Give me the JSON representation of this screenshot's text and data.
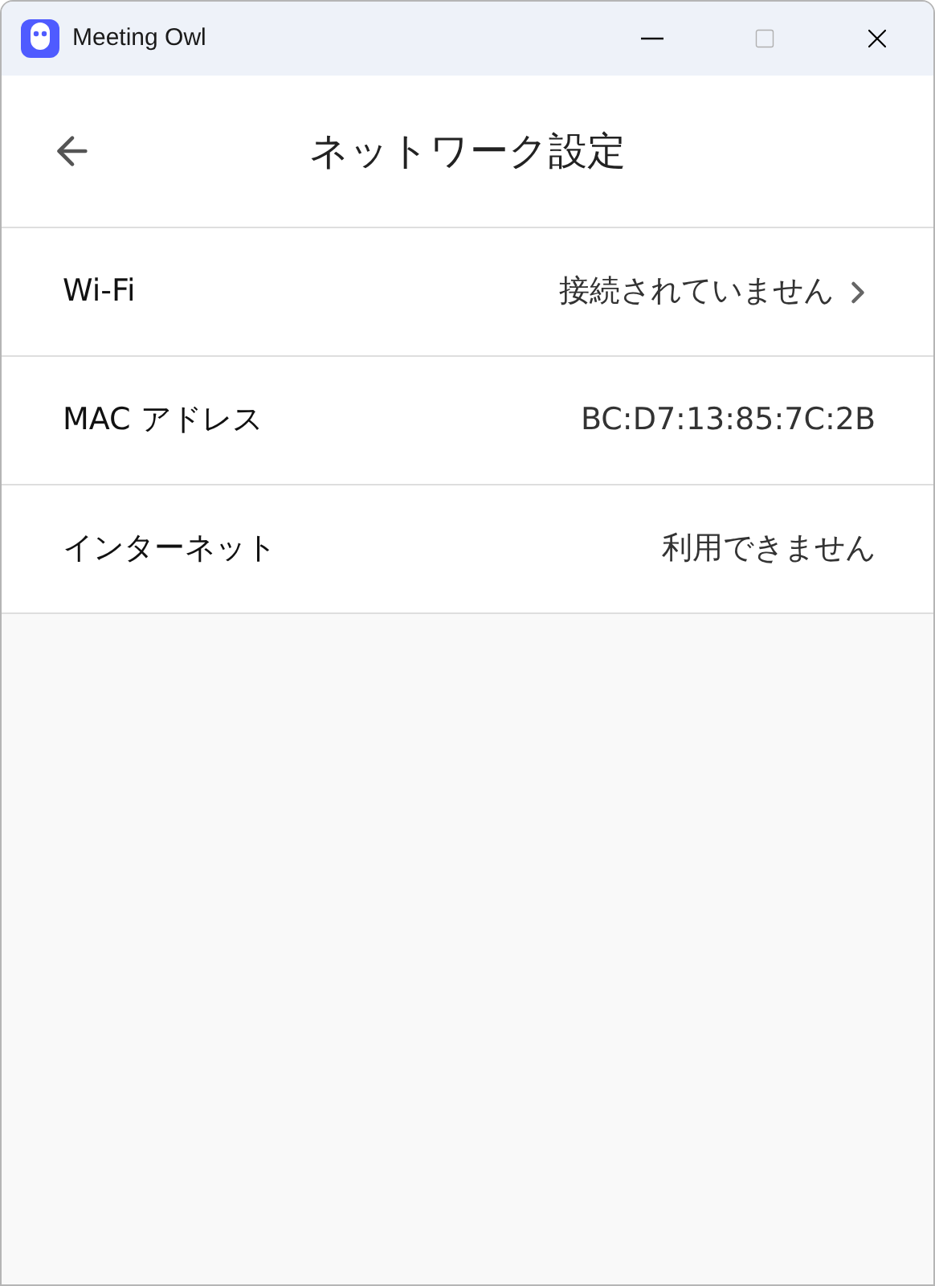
{
  "window": {
    "title": "Meeting Owl"
  },
  "header": {
    "title": "ネットワーク設定"
  },
  "rows": [
    {
      "kind": "link",
      "label": "Wi-Fi",
      "value": "接続されていません"
    },
    {
      "kind": "info",
      "label": "MAC アドレス",
      "value": "BC:D7:13:85:7C:2B"
    },
    {
      "kind": "info",
      "label": "インターネット",
      "value": "利用できません"
    }
  ]
}
